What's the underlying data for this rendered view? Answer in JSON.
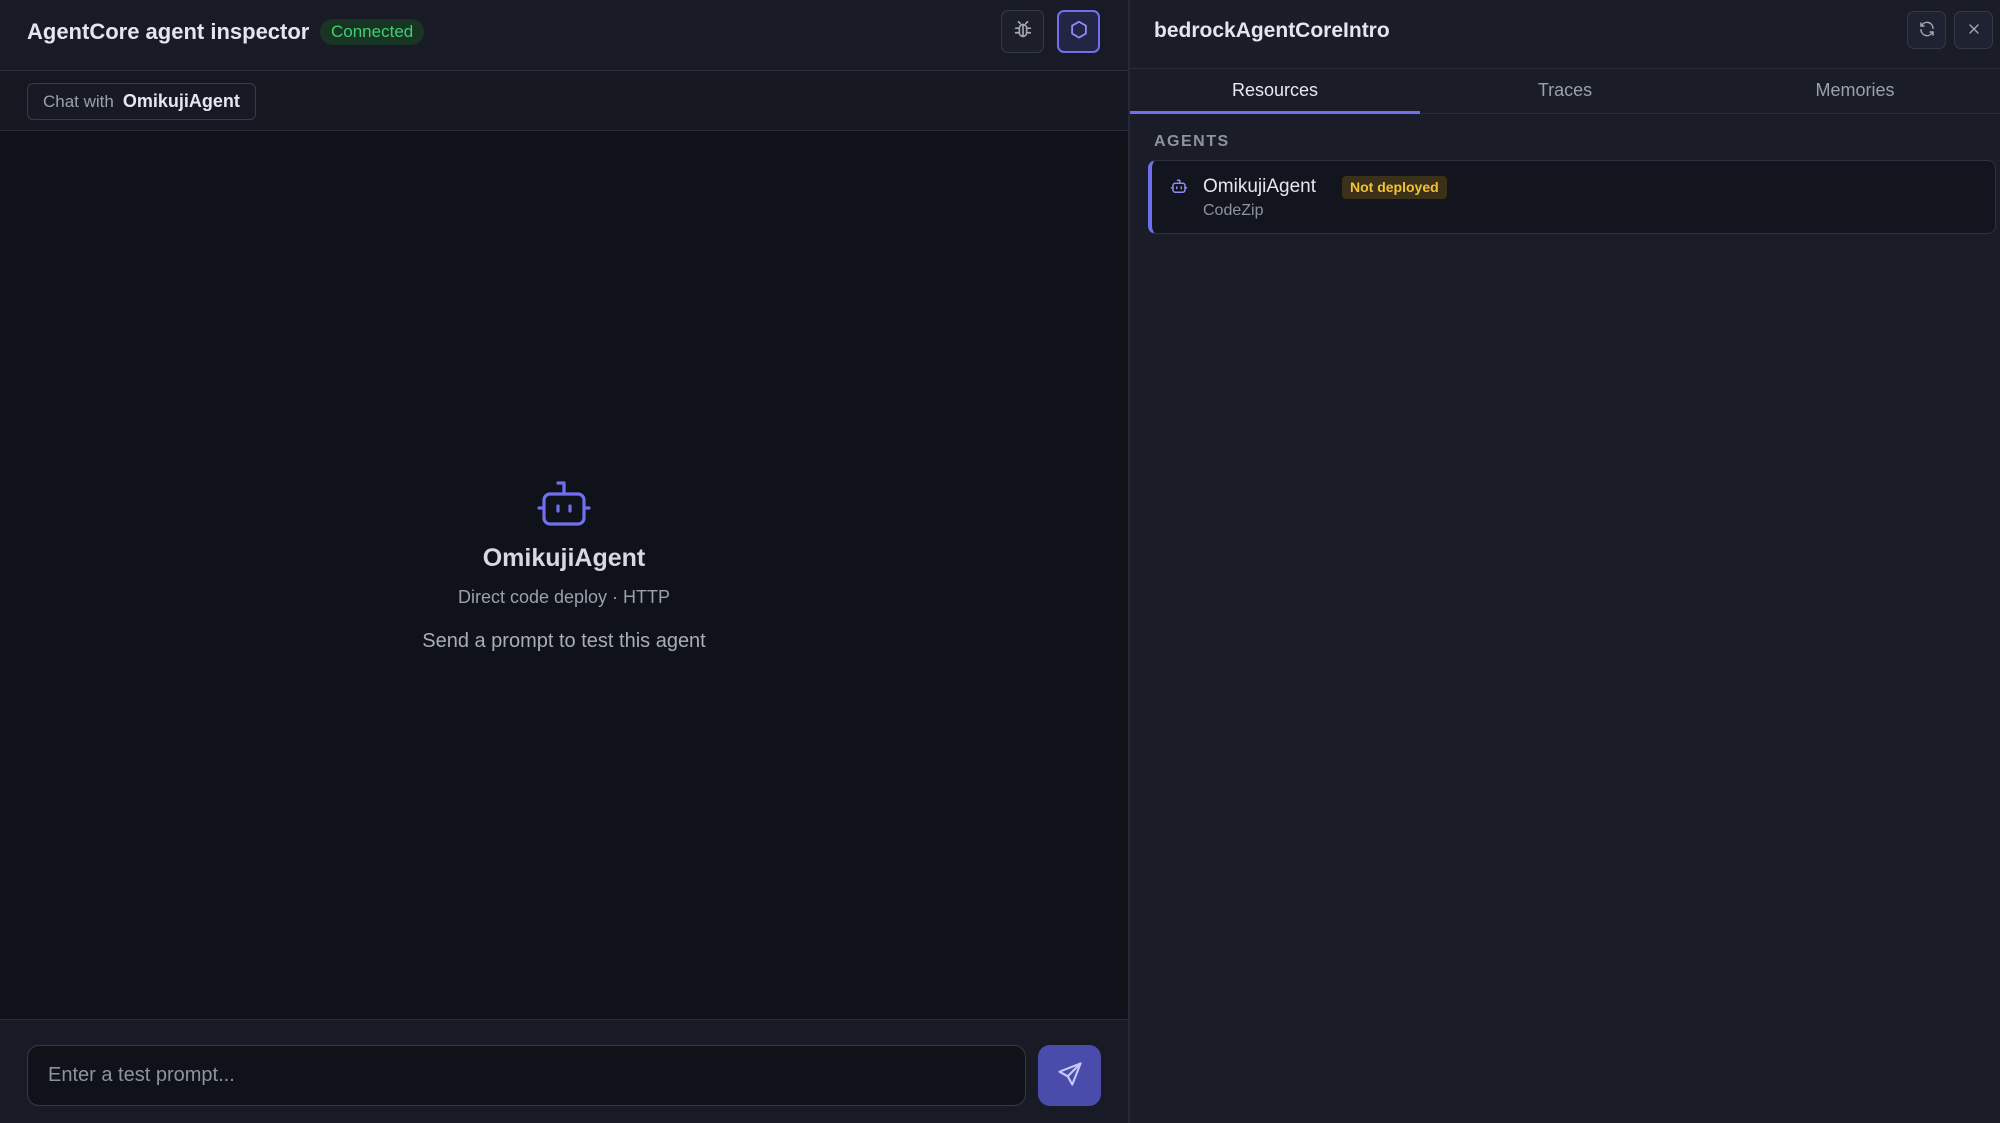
{
  "app": {
    "title": "AgentCore agent inspector",
    "status": "Connected"
  },
  "header_icons": {
    "debug": "bug-icon",
    "inspector": "hexagon-icon"
  },
  "chat": {
    "prefix": "Chat with",
    "agent_name": "OmikujiAgent"
  },
  "empty_state": {
    "icon": "robot-icon",
    "agent_name": "OmikujiAgent",
    "subtitle": "Direct code deploy · HTTP",
    "hint": "Send a prompt to test this agent"
  },
  "composer": {
    "placeholder": "Enter a test prompt...",
    "send_icon": "send-icon"
  },
  "panel": {
    "title": "bedrockAgentCoreIntro",
    "refresh_icon": "refresh-icon",
    "close_icon": "close-icon",
    "tabs": [
      {
        "label": "Resources",
        "active": true
      },
      {
        "label": "Traces",
        "active": false
      },
      {
        "label": "Memories",
        "active": false
      }
    ],
    "section_label": "AGENTS",
    "agents": [
      {
        "name": "OmikujiAgent",
        "badge": "Not deployed",
        "type": "CodeZip",
        "icon": "robot-icon"
      }
    ]
  },
  "colors": {
    "accent": "#6f6ff0",
    "connected": "#3fcf73",
    "warning": "#f4c136",
    "background": "#10121a",
    "panel": "#1a1d28"
  }
}
